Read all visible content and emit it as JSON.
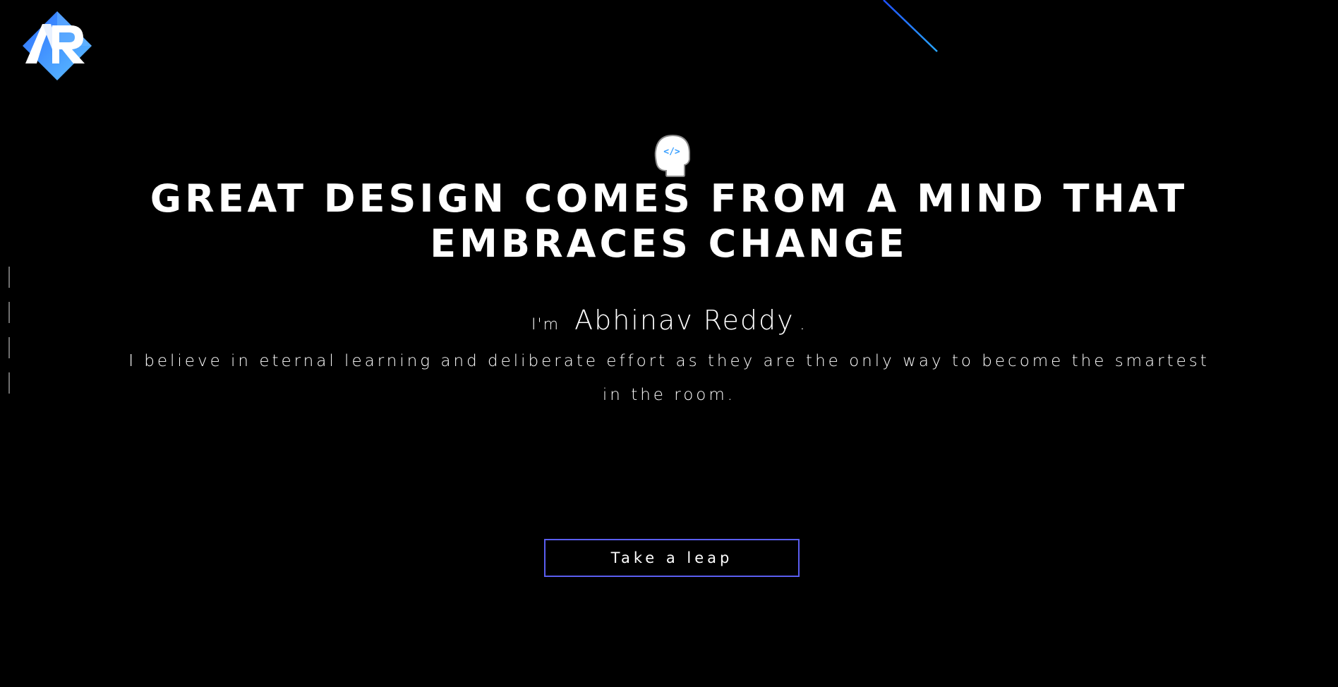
{
  "logo": {
    "text": "AR",
    "icon": "ar-logo-icon",
    "colors": [
      "#1e6fff",
      "#5fb4ff",
      "#ffffff"
    ]
  },
  "hero": {
    "icon": "head-code-icon",
    "headline": "GREAT DESIGN COMES FROM A MIND THAT EMBRACES CHANGE",
    "intro_prefix": "I'm",
    "name": "Abhinav Reddy",
    "name_suffix": ".",
    "tagline": "I believe in eternal learning and deliberate effort as they are the only way to become the smartest in the room.",
    "cta_label": "Take a leap"
  },
  "side_nav": {
    "count": 4,
    "color": "#6f6f6f"
  },
  "colors": {
    "background": "#000000",
    "text": "#ffffff",
    "accent_blue": "#1e8bff",
    "button_border": "#5a5ef0"
  }
}
